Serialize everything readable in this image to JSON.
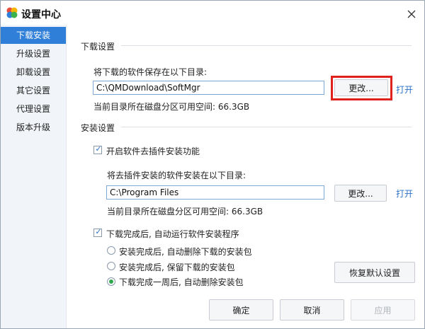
{
  "window": {
    "title": "设置中心"
  },
  "sidebar": {
    "items": [
      {
        "label": "下载安装",
        "active": true
      },
      {
        "label": "升级设置",
        "active": false
      },
      {
        "label": "卸载设置",
        "active": false
      },
      {
        "label": "其它设置",
        "active": false
      },
      {
        "label": "代理设置",
        "active": false
      },
      {
        "label": "版本升级",
        "active": false
      }
    ]
  },
  "download": {
    "section_title": "下载设置",
    "save_label": "将下载的软件保存在以下目录:",
    "path": "C:\\QMDownload\\SoftMgr",
    "change_button": "更改...",
    "open_link": "打开",
    "space_text": "当前目录所在磁盘分区可用空间: 66.3GB"
  },
  "install": {
    "section_title": "安装设置",
    "plugin_checkbox_label": "开启软件去插件安装功能",
    "plugin_checked": true,
    "install_dir_label": "将去插件安装的软件安装在以下目录:",
    "path": "C:\\Program Files",
    "change_button": "更改...",
    "open_link": "打开",
    "space_text": "当前目录所在磁盘分区可用空间: 66.3GB",
    "auto_install_label": "下载完成后, 自动运行软件安装程序",
    "auto_install_checked": true,
    "radio_options": [
      {
        "label": "安装完成后, 自动删除下载的安装包",
        "selected": false
      },
      {
        "label": "安装完成后, 保留下载的安装包",
        "selected": false
      },
      {
        "label": "下载完成一周后, 自动删除安装包",
        "selected": true
      }
    ],
    "restore_defaults_button": "恢复默认设置"
  },
  "footer": {
    "ok_button": "确定",
    "cancel_button": "取消",
    "apply_button": "应用"
  },
  "colors": {
    "accent": "#2f7fd8",
    "link": "#2a72c9",
    "highlight": "#e0221f",
    "radio_selected": "#2fa84f"
  }
}
